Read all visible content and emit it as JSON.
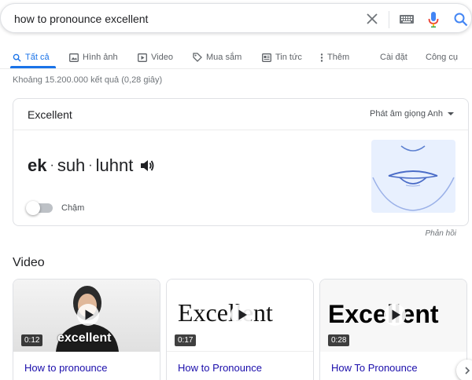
{
  "search": {
    "query": "how to pronounce excellent"
  },
  "tabs": [
    {
      "label": "Tất cả"
    },
    {
      "label": "Hình ảnh"
    },
    {
      "label": "Video"
    },
    {
      "label": "Mua sắm"
    },
    {
      "label": "Tin tức"
    },
    {
      "label": "Thêm"
    }
  ],
  "tools": {
    "settings": "Cài đặt",
    "tools": "Công cụ"
  },
  "stats": "Khoảng 15.200.000 kết quả (0,28 giây)",
  "pronounce": {
    "word": "Excellent",
    "accent": "Phát âm giọng Anh",
    "syllables": [
      "ek",
      "suh",
      "luhnt"
    ],
    "slow_label": "Chậm"
  },
  "feedback": "Phản hồi",
  "videos": {
    "heading": "Video",
    "items": [
      {
        "duration": "0:12",
        "caption": "How to pronounce",
        "overlay": "excellent"
      },
      {
        "duration": "0:17",
        "caption": "How to Pronounce",
        "overlay": "Excellent"
      },
      {
        "duration": "0:28",
        "caption": "How To Pronounce",
        "overlay": "Excellent"
      }
    ]
  },
  "colors": {
    "accent": "#1a73e8",
    "link": "#1a0dab"
  }
}
